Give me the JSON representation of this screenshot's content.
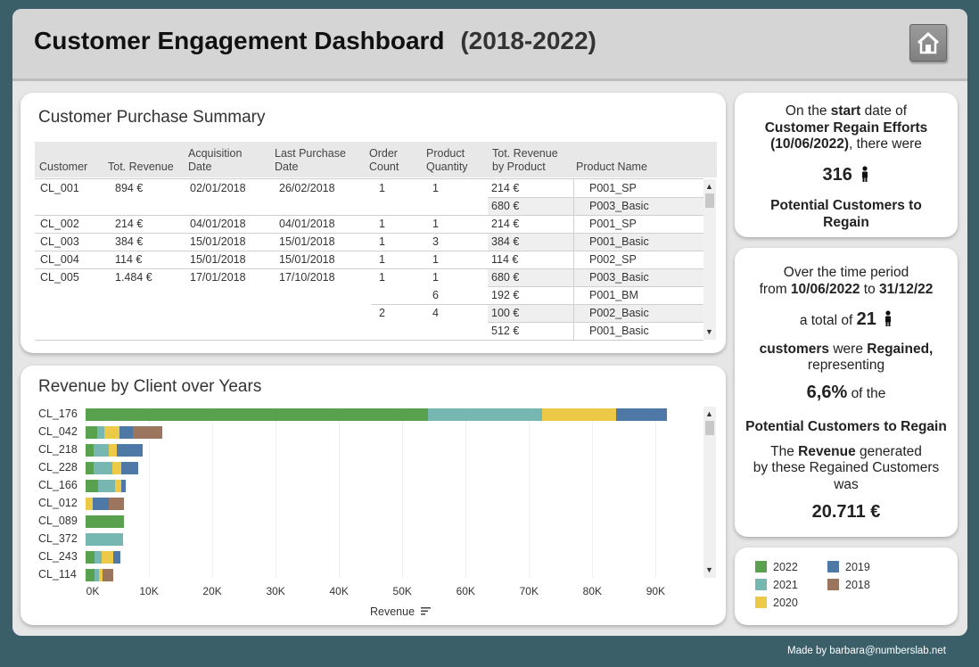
{
  "header": {
    "title": "Customer Engagement Dashboard",
    "years": "(2018-2022)"
  },
  "summary": {
    "title": "Customer Purchase Summary",
    "columns": [
      "Customer",
      "Tot. Revenue",
      "Acquisition Date",
      "Last Purchase Date",
      "Order Count",
      "Product Quantity",
      "Tot. Revenue by Product",
      "Product Name"
    ],
    "rows": [
      [
        "CL_001",
        "894 €",
        "02/01/2018",
        "26/02/2018",
        "1",
        "1",
        "214 €",
        "P001_SP"
      ],
      [
        "",
        "",
        "",
        "",
        "",
        "",
        "680 €",
        "P003_Basic"
      ],
      [
        "CL_002",
        "214 €",
        "04/01/2018",
        "04/01/2018",
        "1",
        "1",
        "214 €",
        "P001_SP"
      ],
      [
        "CL_003",
        "384 €",
        "15/01/2018",
        "15/01/2018",
        "1",
        "3",
        "384 €",
        "P001_Basic"
      ],
      [
        "CL_004",
        "114 €",
        "15/01/2018",
        "15/01/2018",
        "1",
        "1",
        "114 €",
        "P002_SP"
      ],
      [
        "CL_005",
        "1.484 €",
        "17/01/2018",
        "17/10/2018",
        "1",
        "1",
        "680 €",
        "P003_Basic"
      ],
      [
        "",
        "",
        "",
        "",
        "",
        "6",
        "192 €",
        "P001_BM"
      ],
      [
        "",
        "",
        "",
        "",
        "2",
        "4",
        "100 €",
        "P002_Basic"
      ],
      [
        "",
        "",
        "",
        "",
        "",
        "",
        "512 €",
        "P001_Basic"
      ]
    ]
  },
  "revenue_chart": {
    "title": "Revenue by Client over Years"
  },
  "chart_data": {
    "type": "bar",
    "orientation": "horizontal",
    "stacked": true,
    "categories": [
      "CL_176",
      "CL_042",
      "CL_218",
      "CL_228",
      "CL_166",
      "CL_012",
      "CL_089",
      "CL_372",
      "CL_243",
      "CL_114"
    ],
    "series": [
      {
        "name": "2022",
        "color": "#59a14f",
        "values": [
          54000,
          1900,
          1200,
          1200,
          2000,
          0,
          6100,
          0,
          1400,
          1400
        ]
      },
      {
        "name": "2021",
        "color": "#76b7b2",
        "values": [
          18000,
          1100,
          2400,
          3000,
          2700,
          0,
          0,
          5900,
          1200,
          700
        ]
      },
      {
        "name": "2020",
        "color": "#edc948",
        "values": [
          11700,
          2300,
          1300,
          1500,
          1000,
          1100,
          0,
          0,
          1700,
          600
        ]
      },
      {
        "name": "2019",
        "color": "#4e79a7",
        "values": [
          8100,
          2200,
          4100,
          2600,
          600,
          2500,
          0,
          0,
          1200,
          0
        ]
      },
      {
        "name": "2018",
        "color": "#9c755f",
        "values": [
          0,
          4600,
          0,
          0,
          0,
          2500,
          0,
          0,
          0,
          1700
        ]
      }
    ],
    "xlabel": "Revenue",
    "xlim": [
      0,
      96000
    ],
    "xticks": [
      "0K",
      "10K",
      "20K",
      "30K",
      "40K",
      "50K",
      "60K",
      "70K",
      "80K",
      "90K"
    ],
    "grid": true
  },
  "start_card": {
    "line1_pre": "On the ",
    "line1_bold": "start",
    "line1_post": " date of",
    "line2": "Customer Regain Efforts",
    "line3_bold": "(10/06/2022)",
    "line3_post": ", there were",
    "count": "316",
    "label": "Potential Customers to Regain"
  },
  "period_card": {
    "line1": "Over the time period",
    "from_pre": "from ",
    "from_date": "10/06/2022",
    "to_word": " to ",
    "to_date": "31/12/22",
    "total_pre": "a total of ",
    "total": "21",
    "cust_bold": "customers",
    "were": " were ",
    "regained": "Regained,",
    "representing": "representing",
    "pct": "6,6%",
    "of_the": "of the",
    "pcr": "Potential Customers to Regain",
    "rev_pre": "The ",
    "rev_bold": "Revenue",
    "rev_post": " generated",
    "rev_line2": "by these Regained Customers",
    "rev_line3": "was",
    "revenue": "20.711 €"
  },
  "legend": [
    {
      "label": "2022",
      "color": "#59a14f"
    },
    {
      "label": "2019",
      "color": "#4e79a7"
    },
    {
      "label": "2021",
      "color": "#76b7b2"
    },
    {
      "label": "2018",
      "color": "#9c755f"
    },
    {
      "label": "2020",
      "color": "#edc948"
    }
  ],
  "footer": "Made by barbara@numberslab.net"
}
